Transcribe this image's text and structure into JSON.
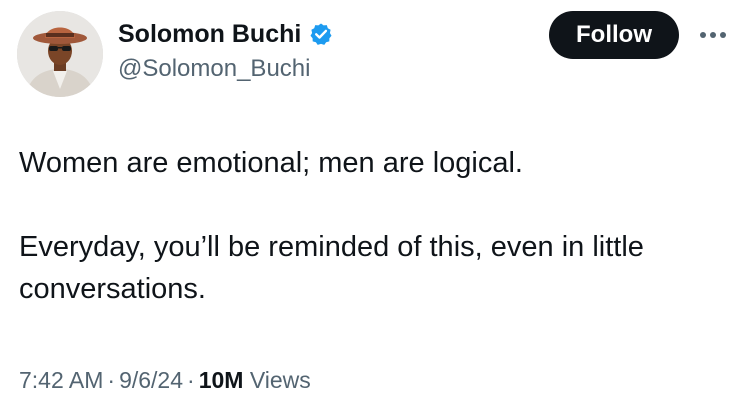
{
  "author": {
    "display_name": "Solomon Buchi",
    "handle": "@Solomon_Buchi",
    "verified": true
  },
  "actions": {
    "follow_label": "Follow",
    "more_icon": "more-horizontal-icon"
  },
  "tweet": {
    "paragraphs": [
      "Women are emotional; men are logical.",
      "Everyday, you’ll be reminded of this, even in little conversations."
    ]
  },
  "meta": {
    "time": "7:42 AM",
    "separator": "·",
    "date": "9/6/24",
    "views_count": "10M",
    "views_label": "Views"
  },
  "colors": {
    "text_primary": "#0f1419",
    "text_secondary": "#536471",
    "verified_blue": "#1d9bf0",
    "follow_bg": "#0f1419"
  }
}
